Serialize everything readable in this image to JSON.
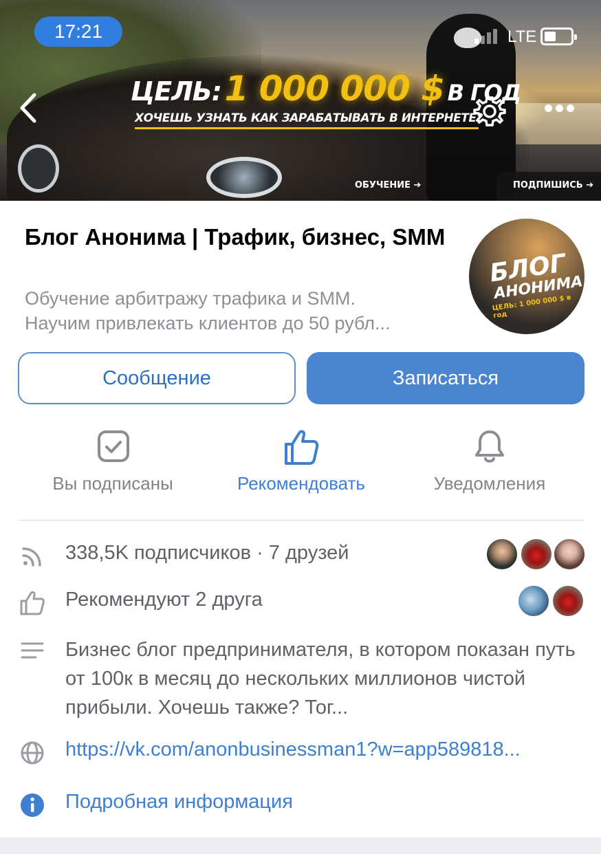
{
  "status_bar": {
    "time": "17:21",
    "network": "LTE",
    "battery_level": 0.45
  },
  "cover": {
    "goal_prefix": "ЦЕЛЬ:",
    "goal_amount": "1 000 000 $",
    "goal_suffix": "В ГОД",
    "subtitle": "ХОЧЕШЬ УЗНАТЬ КАК ЗАРАБАТЫВАТЬ В ИНТЕРНЕТЕ?",
    "learn_label": "ОБУЧЕНИЕ",
    "subscribe_label": "ПОДПИШИСЬ"
  },
  "nav": {
    "back_icon": "chevron-left-icon",
    "settings_icon": "gear-icon",
    "more_icon": "more-dots-icon"
  },
  "group": {
    "name": "Блог Анонима | Трафик, бизнес, SMM",
    "status_line1": "Обучение арбитражу трафика и SMM.",
    "status_line2": "Научим привлекать клиентов до 50 рубл...",
    "avatar_line1": "БЛОГ",
    "avatar_line2": "АНОНИМА",
    "avatar_line3": "ЦЕЛЬ: 1 000 000 $ в год"
  },
  "buttons": {
    "message": "Сообщение",
    "join": "Записаться"
  },
  "actions": {
    "subscribed": "Вы подписаны",
    "recommend": "Рекомендовать",
    "notifications": "Уведомления"
  },
  "info": {
    "followers": "338,5K подписчиков · 7 друзей",
    "recommend": "Рекомендуют 2 друга",
    "description": "Бизнес блог предпринимателя, в котором показан путь от 100к в месяц до нескольких миллионов чистой прибыли. Хочешь также? Тог...",
    "link": "https://vk.com/anonbusinessman1?w=app589818...",
    "more": "Подробная информация"
  },
  "colors": {
    "accent": "#4a86cf",
    "link": "#3e7fd0",
    "muted": "#818589",
    "cover_gold": "#f2c012"
  }
}
